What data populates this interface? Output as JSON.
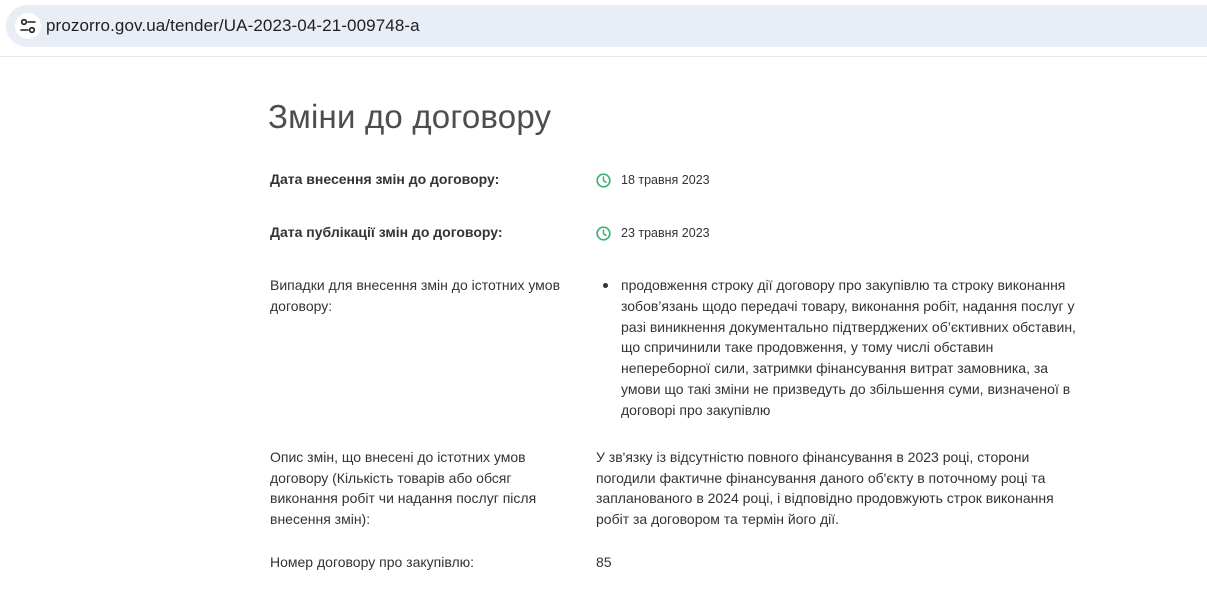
{
  "browser": {
    "url": "prozorro.gov.ua/tender/UA-2023-04-21-009748-a",
    "site_icon": "site-settings-icon"
  },
  "page": {
    "title": "Зміни до договору",
    "fields": {
      "change_date": {
        "label": "Дата внесення змін до договору:",
        "value": "18 травня 2023",
        "icon": "clock-icon"
      },
      "publication_date": {
        "label": "Дата публікації змін до договору:",
        "value": "23 травня 2023",
        "icon": "clock-icon"
      },
      "change_cases": {
        "label": "Випадки для внесення змін до істотних умов договору:",
        "items": [
          "продовження строку дії договору про закупівлю та строку виконання зобов’язань щодо передачі товару, виконання робіт, надання послуг у разі виникнення документально підтверджених об’єктивних обставин, що спричинили таке продовження, у тому числі обставин непереборної сили, затримки фінансування витрат замовника, за умови що такі зміни не призведуть до збільшення суми, визначеної в договорі про закупівлю"
        ]
      },
      "change_description": {
        "label": "Опис змін, що внесені до істотних умов договору (Кількість товарів або обсяг виконання робіт чи надання послуг після внесення змін):",
        "value": "У зв'язку із відсутністю повного фінансування в 2023 році, сторони погодили фактичне фінансування даного об'єкту в поточному році та запланованого в 2024 році, і відповідно продовжують строк виконання робіт за договором та термін його дії."
      },
      "contract_number": {
        "label": "Номер договору про закупівлю:",
        "value": "85"
      }
    },
    "colors": {
      "clock_icon": "#3cb371",
      "url_bar_bg": "#e8edf6",
      "text": "#333333"
    }
  }
}
